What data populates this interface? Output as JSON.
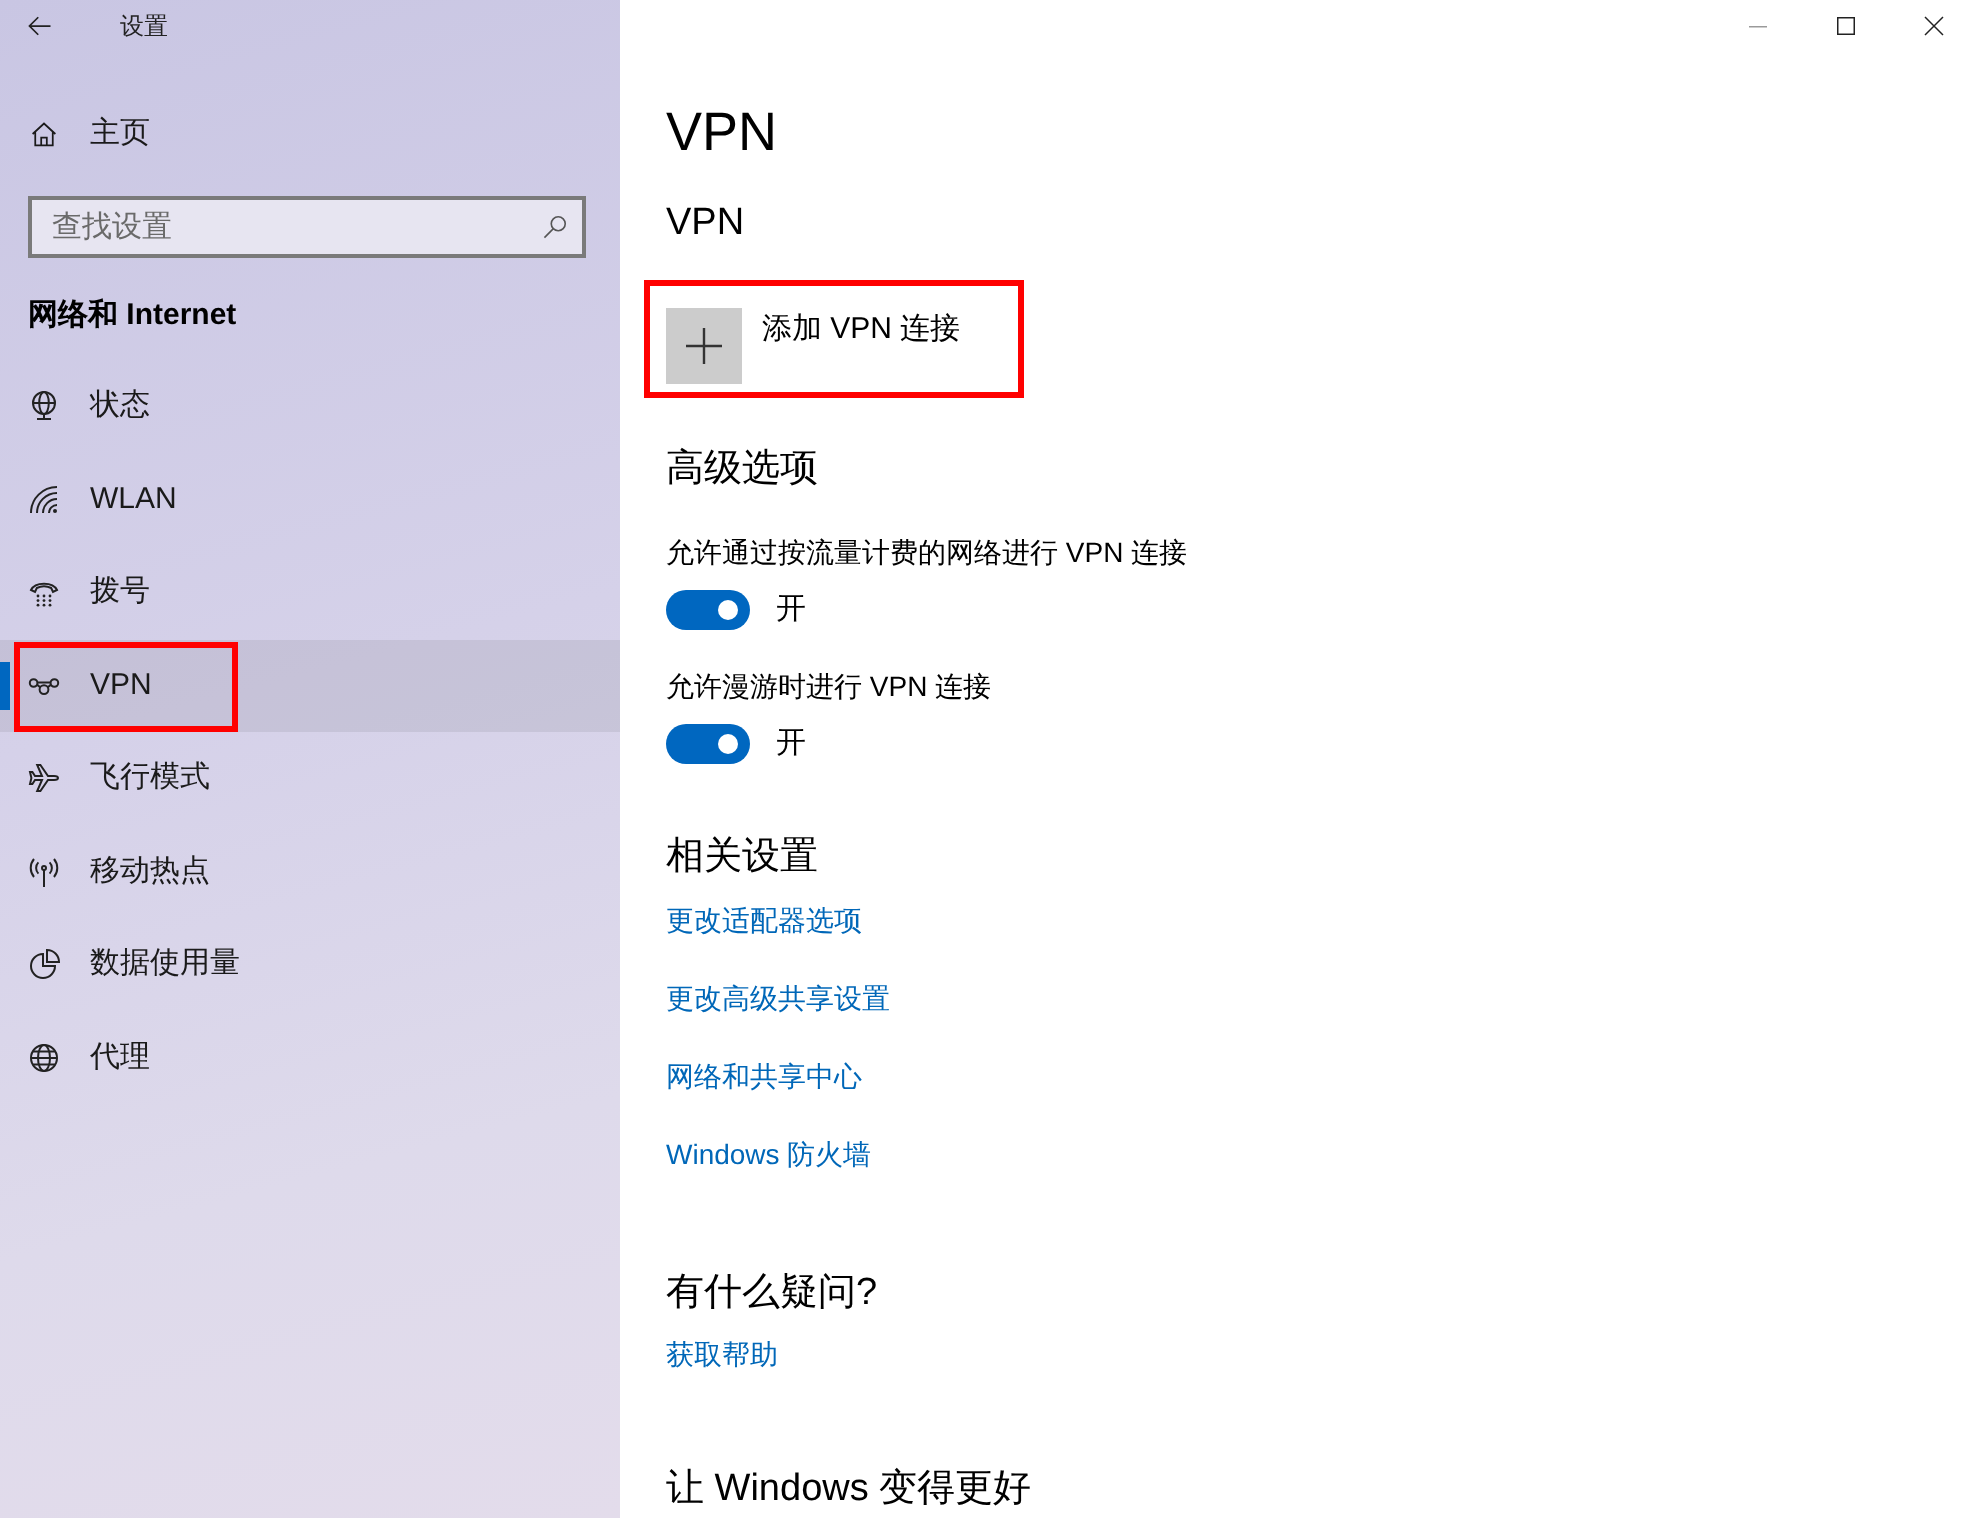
{
  "window": {
    "title": "设置"
  },
  "sidebar": {
    "home": {
      "label": "主页"
    },
    "search": {
      "placeholder": "查找设置"
    },
    "section_title": "网络和 Internet",
    "items": [
      {
        "label": "状态",
        "selected": false,
        "highlighted": false
      },
      {
        "label": "WLAN",
        "selected": false,
        "highlighted": false
      },
      {
        "label": "拨号",
        "selected": false,
        "highlighted": false
      },
      {
        "label": "VPN",
        "selected": true,
        "highlighted": true
      },
      {
        "label": "飞行模式",
        "selected": false,
        "highlighted": false
      },
      {
        "label": "移动热点",
        "selected": false,
        "highlighted": false
      },
      {
        "label": "数据使用量",
        "selected": false,
        "highlighted": false
      },
      {
        "label": "代理",
        "selected": false,
        "highlighted": false
      }
    ]
  },
  "content": {
    "title": "VPN",
    "vpn": {
      "heading": "VPN",
      "add_button": {
        "label": "添加 VPN 连接",
        "highlighted": true
      }
    },
    "advanced": {
      "heading": "高级选项",
      "options": [
        {
          "label": "允许通过按流量计费的网络进行 VPN 连接",
          "on": true,
          "state_label": "开"
        },
        {
          "label": "允许漫游时进行 VPN 连接",
          "on": true,
          "state_label": "开"
        }
      ]
    },
    "related": {
      "heading": "相关设置",
      "links": [
        "更改适配器选项",
        "更改高级共享设置",
        "网络和共享中心",
        "Windows 防火墙"
      ]
    },
    "help": {
      "heading": "有什么疑问?",
      "links": [
        "获取帮助"
      ]
    },
    "feedback": {
      "heading": "让 Windows 变得更好"
    }
  }
}
